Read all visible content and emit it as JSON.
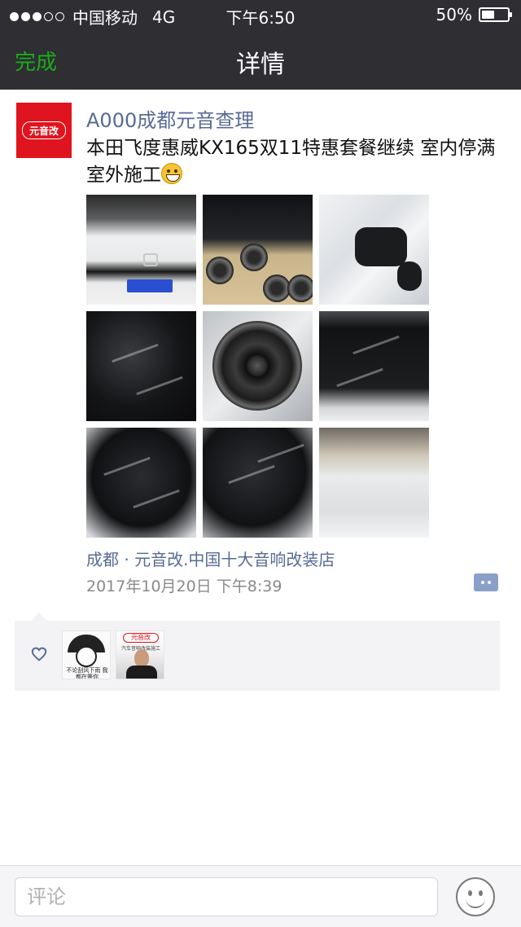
{
  "status_bar": {
    "carrier": "中国移动",
    "network": "4G",
    "time": "下午6:50",
    "battery_text": "50%",
    "battery_level": 0.5,
    "signal_bars_filled": 3,
    "signal_bars_total": 5
  },
  "nav": {
    "done_label": "完成",
    "title": "详情"
  },
  "post": {
    "avatar_text": "元音改",
    "author": "A000成都元音查理",
    "content": "本田飞度惠威KX165双11特惠套餐继续 室内停满室外施工",
    "content_emoji": "grinning-face-emoji",
    "photos": [
      {
        "name": "white-honda-fit-front"
      },
      {
        "name": "sound-deadening-speakers-display"
      },
      {
        "name": "door-panel-interior"
      },
      {
        "name": "door-with-deadening-mat"
      },
      {
        "name": "door-speaker-installed"
      },
      {
        "name": "door-deadening-full"
      },
      {
        "name": "door-deadening-mat-1"
      },
      {
        "name": "door-deadening-mat-2"
      },
      {
        "name": "car-floor-deadening"
      }
    ],
    "location": "成都 · 元音改.中国十大音响改装店",
    "timestamp": "2017年10月20日 下午8:39",
    "action_icon": "comment-more-icon"
  },
  "likes": {
    "icon": "heart-icon",
    "likers": [
      {
        "caption": "不论刮风下雨 我都在等你"
      },
      {
        "banner": "元音改",
        "caption": "汽车音响改装施工"
      }
    ]
  },
  "bottom_bar": {
    "comment_placeholder": "评论",
    "emoji_icon": "smiley-icon"
  },
  "colors": {
    "nav_bg": "#2e2e33",
    "accent_green": "#1aad19",
    "link_blue": "#576b95",
    "brand_red": "#e0141e"
  }
}
